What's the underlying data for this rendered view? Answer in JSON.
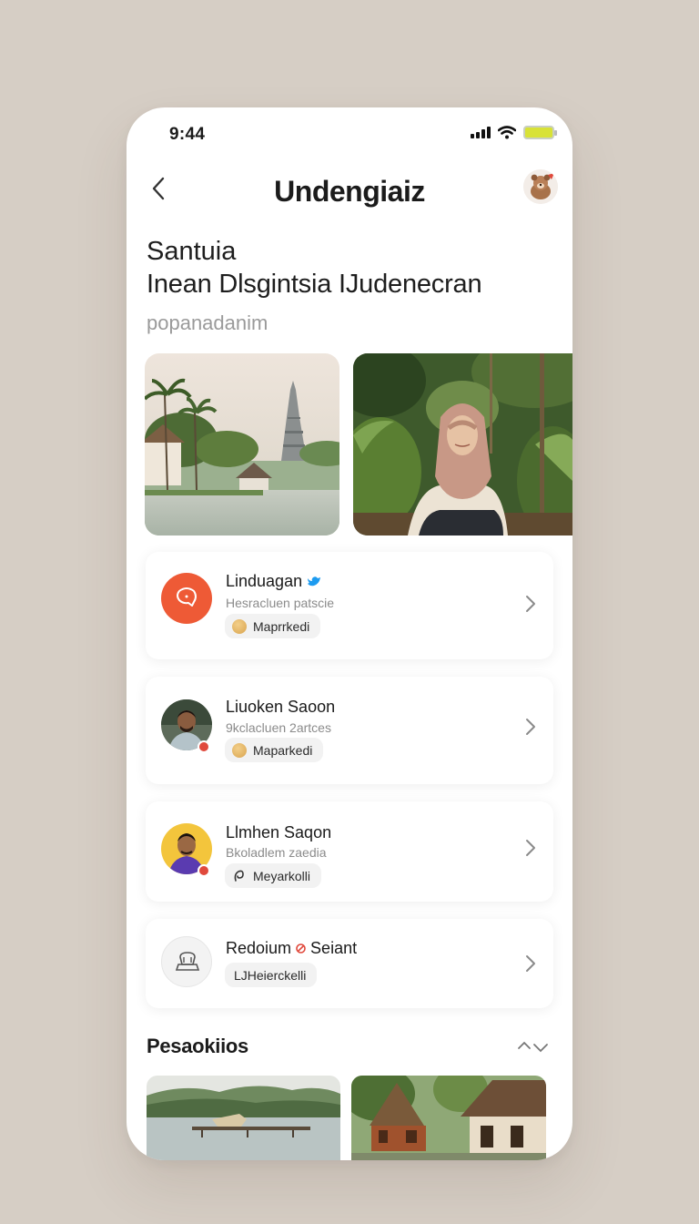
{
  "status_bar": {
    "time": "9:44"
  },
  "header": {
    "title": "Undengiaiz",
    "back_icon": "chevron-left-icon",
    "profile_icon": "avatar-icon"
  },
  "intro": {
    "line1": "Santuia",
    "line2": "Inean Dlsgintsia IJudenecran",
    "line3": "popanadanim"
  },
  "hero_images": [
    {
      "name": "temple-river-photo"
    },
    {
      "name": "woman-forest-photo"
    }
  ],
  "contacts": [
    {
      "name": "Linduagan",
      "subtitle": "Hesracluen patscie",
      "chip": "Maprrkedi",
      "verified": true,
      "avatar": "orange-chat-icon"
    },
    {
      "name": "Liuoken Saoon",
      "subtitle": "9kclacluen 2artces",
      "chip": "Maparkedi",
      "avatar": "man-portrait"
    },
    {
      "name": "Llmhen Saqon",
      "subtitle": "Bkoladlem zaedia",
      "chip": "Meyarkolli",
      "avatar": "man-portrait-yellow"
    },
    {
      "name": "Redoium",
      "name_suffix": "Seiant",
      "subtitle": "",
      "chip": "LJHeierckelli",
      "avatar": "stamp-icon"
    }
  ],
  "section": {
    "title": "Pesaokiios"
  },
  "colors": {
    "accent": "#ee5a36",
    "verified": "#1d9bf0",
    "badge": "#e0493c",
    "battery": "#d8e236"
  }
}
